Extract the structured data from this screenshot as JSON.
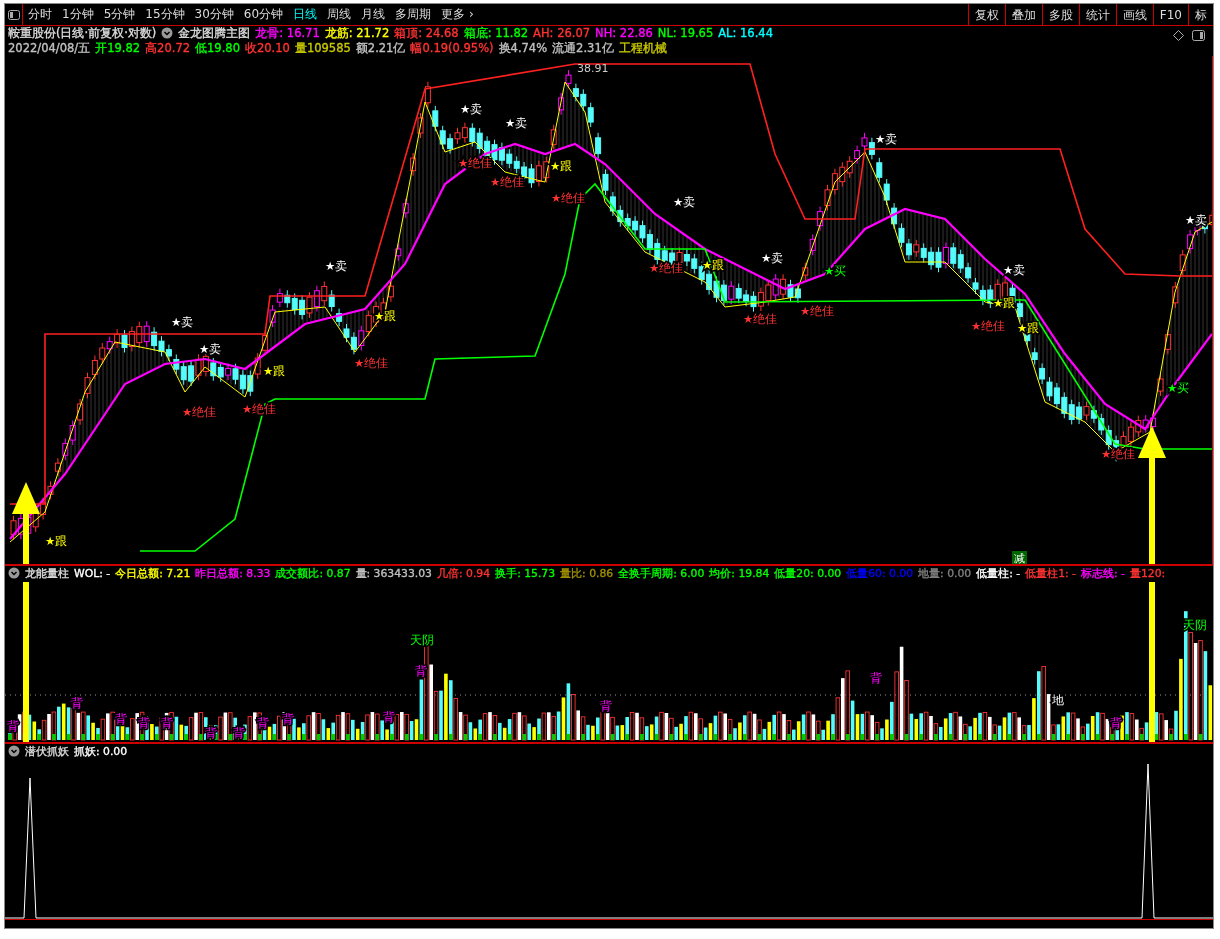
{
  "toolbar": {
    "tabs": [
      {
        "label": "分时",
        "selected": false
      },
      {
        "label": "1分钟",
        "selected": false
      },
      {
        "label": "5分钟",
        "selected": false
      },
      {
        "label": "15分钟",
        "selected": false
      },
      {
        "label": "30分钟",
        "selected": false
      },
      {
        "label": "60分钟",
        "selected": false
      },
      {
        "label": "日线",
        "selected": true
      },
      {
        "label": "周线",
        "selected": false
      },
      {
        "label": "月线",
        "selected": false
      },
      {
        "label": "多周期",
        "selected": false
      },
      {
        "label": "更多 ›",
        "selected": false
      }
    ],
    "buttons": [
      "复权",
      "叠加",
      "多股",
      "统计",
      "画线",
      "F10",
      "标"
    ]
  },
  "main_chart": {
    "title": "鞍重股份(日线·前复权·对数)",
    "indicator": "金龙图腾主图",
    "values": [
      {
        "text": "龙骨: 16.71",
        "color": "#ff00ff"
      },
      {
        "text": "龙筋: 21.72",
        "color": "#ffff00"
      },
      {
        "text": "箱顶: 24.68",
        "color": "#ff3232"
      },
      {
        "text": "箱底: 11.82",
        "color": "#00ff00"
      },
      {
        "text": "AH: 26.07",
        "color": "#ff3232"
      },
      {
        "text": "NH: 22.86",
        "color": "#ff00ff"
      },
      {
        "text": "NL: 19.65",
        "color": "#00ff00"
      },
      {
        "text": "AL: 16.44",
        "color": "#00ffff"
      }
    ],
    "quote": [
      {
        "text": "2022/04/08/五",
        "color": "#c0c0c0"
      },
      {
        "text": "开19.82",
        "color": "#00ff00"
      },
      {
        "text": "高20.72",
        "color": "#ff3232"
      },
      {
        "text": "低19.80",
        "color": "#00ff00"
      },
      {
        "text": "收20.10",
        "color": "#ff3232"
      },
      {
        "text": "量109585",
        "color": "#c8c800"
      },
      {
        "text": "额2.21亿",
        "color": "#c0c0c0"
      },
      {
        "text": "幅0.19(0.95%)",
        "color": "#ff3232"
      },
      {
        "text": "换4.74%",
        "color": "#c0c0c0"
      },
      {
        "text": "流通2.31亿",
        "color": "#c0c0c0"
      },
      {
        "text": "工程机械",
        "color": "#c8c800"
      }
    ],
    "price_label": "38.91",
    "signals": [
      {
        "kind": "sell",
        "label": "★卖"
      },
      {
        "kind": "sell",
        "label": "★卖"
      },
      {
        "kind": "sell",
        "label": "★卖"
      },
      {
        "kind": "sell",
        "label": "★卖"
      },
      {
        "kind": "sell",
        "label": "★卖"
      },
      {
        "kind": "sell",
        "label": "★卖"
      },
      {
        "kind": "sell",
        "label": "★卖"
      },
      {
        "kind": "sell",
        "label": "★卖"
      },
      {
        "kind": "sell",
        "label": "★卖"
      },
      {
        "kind": "sell",
        "label": "★卖"
      },
      {
        "kind": "follow",
        "label": "★跟"
      },
      {
        "kind": "follow",
        "label": "★跟"
      },
      {
        "kind": "follow",
        "label": "★跟"
      },
      {
        "kind": "follow",
        "label": "★跟"
      },
      {
        "kind": "follow",
        "label": "★跟"
      },
      {
        "kind": "follow",
        "label": "★跟"
      },
      {
        "kind": "follow",
        "label": "★跟"
      },
      {
        "kind": "best",
        "label": "★绝佳"
      },
      {
        "kind": "best",
        "label": "★绝佳"
      },
      {
        "kind": "best",
        "label": "★绝佳"
      },
      {
        "kind": "best",
        "label": "★绝佳"
      },
      {
        "kind": "best",
        "label": "★绝佳"
      },
      {
        "kind": "best",
        "label": "★绝佳"
      },
      {
        "kind": "best",
        "label": "★绝佳"
      },
      {
        "kind": "best",
        "label": "★绝佳"
      },
      {
        "kind": "best",
        "label": "★绝佳"
      },
      {
        "kind": "best",
        "label": "★绝佳"
      },
      {
        "kind": "best",
        "label": "★绝佳"
      },
      {
        "kind": "buy",
        "label": "★买"
      },
      {
        "kind": "buy",
        "label": "★买"
      },
      {
        "kind": "cut",
        "label": "减"
      }
    ]
  },
  "volume_panel": {
    "name": "龙能量柱",
    "values": [
      {
        "text": "WOL: -",
        "color": "#ffffff"
      },
      {
        "text": "今日总额: 7.21",
        "color": "#ffff00"
      },
      {
        "text": "昨日总额: 8.33",
        "color": "#ff00ff"
      },
      {
        "text": "成交额比: 0.87",
        "color": "#00ff00"
      },
      {
        "text": "量: 363433.03",
        "color": "#c0c0c0"
      },
      {
        "text": "几倍: 0.94",
        "color": "#ff3232"
      },
      {
        "text": "换手: 15.73",
        "color": "#00ff00"
      },
      {
        "text": "量比: 0.86",
        "color": "#a09000"
      },
      {
        "text": "全换手周期: 6.00",
        "color": "#00ff00"
      },
      {
        "text": "均价: 19.84",
        "color": "#00ff00"
      },
      {
        "text": "低量20: 0.00",
        "color": "#00ff00"
      },
      {
        "text": "低量60: 0.00",
        "color": "#0000ff"
      },
      {
        "text": "地量: 0.00",
        "color": "#808080"
      },
      {
        "text": "低量柱: -",
        "color": "#ffffff"
      },
      {
        "text": "低量柱1: -",
        "color": "#ff3232"
      },
      {
        "text": "标志线: -",
        "color": "#ff00ff"
      },
      {
        "text": "量120:",
        "color": "#ff3232"
      }
    ],
    "labels": [
      {
        "kind": "sky",
        "label": "天阴"
      },
      {
        "kind": "sky",
        "label": "天阴"
      },
      {
        "kind": "back",
        "label": "背"
      },
      {
        "kind": "back",
        "label": "背"
      },
      {
        "kind": "back",
        "label": "背"
      },
      {
        "kind": "back",
        "label": "背"
      },
      {
        "kind": "back",
        "label": "背"
      },
      {
        "kind": "back",
        "label": "背"
      },
      {
        "kind": "back",
        "label": "背"
      },
      {
        "kind": "back",
        "label": "背"
      },
      {
        "kind": "back",
        "label": "背"
      },
      {
        "kind": "back",
        "label": "背"
      },
      {
        "kind": "back",
        "label": "背"
      },
      {
        "kind": "back",
        "label": "背"
      },
      {
        "kind": "back",
        "label": "背"
      },
      {
        "kind": "back",
        "label": "背"
      },
      {
        "kind": "ground",
        "label": "地"
      }
    ]
  },
  "lower_panel": {
    "name": "潜伏抓妖",
    "values": [
      {
        "text": "抓妖: 0.00",
        "color": "#ffffff"
      }
    ]
  }
}
